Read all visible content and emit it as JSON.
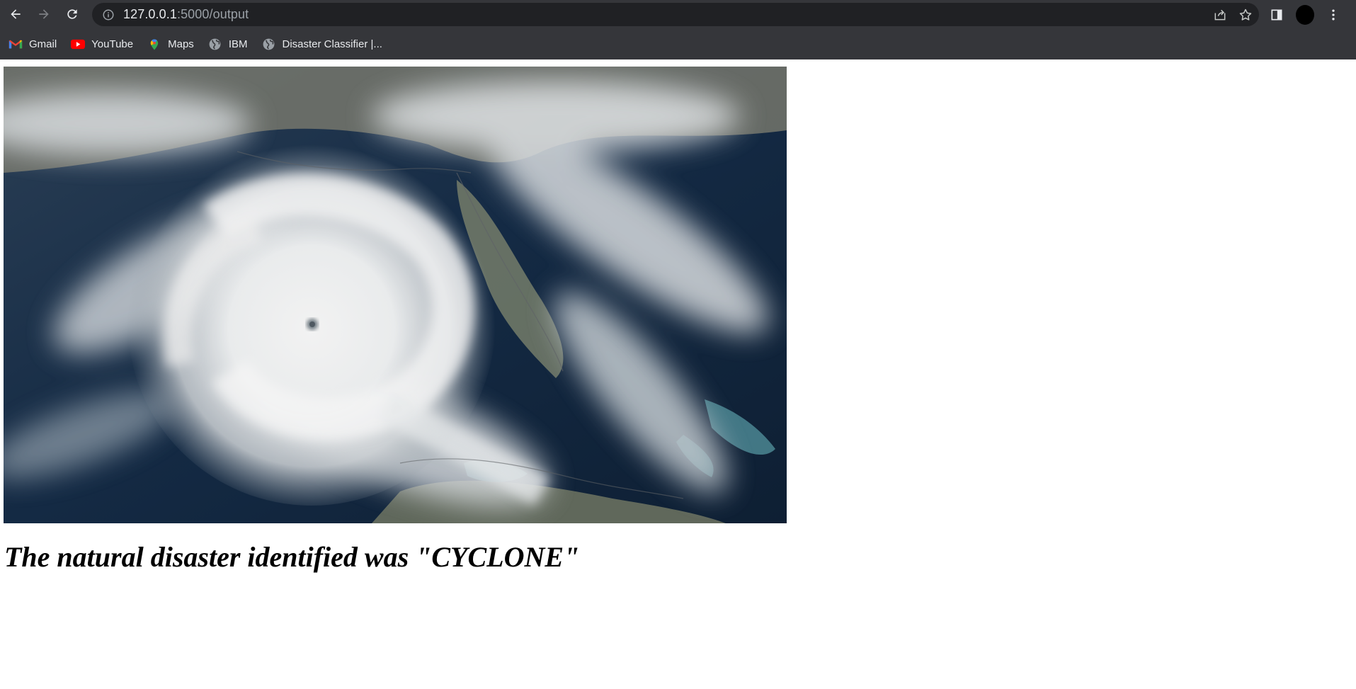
{
  "browser": {
    "url_host": "127.0.0.1",
    "url_path": ":5000/output",
    "bookmarks": [
      {
        "label": "Gmail",
        "icon": "gmail-icon"
      },
      {
        "label": "YouTube",
        "icon": "youtube-icon"
      },
      {
        "label": "Maps",
        "icon": "maps-icon"
      },
      {
        "label": "IBM",
        "icon": "globe-icon"
      },
      {
        "label": "Disaster Classifier |...",
        "icon": "globe-icon"
      }
    ]
  },
  "page": {
    "result_text": "The natural disaster identified was \"CYCLONE\""
  },
  "colors": {
    "chrome_bg": "#35363a",
    "omnibox_bg": "#202124",
    "text_light": "#e8eaed"
  }
}
